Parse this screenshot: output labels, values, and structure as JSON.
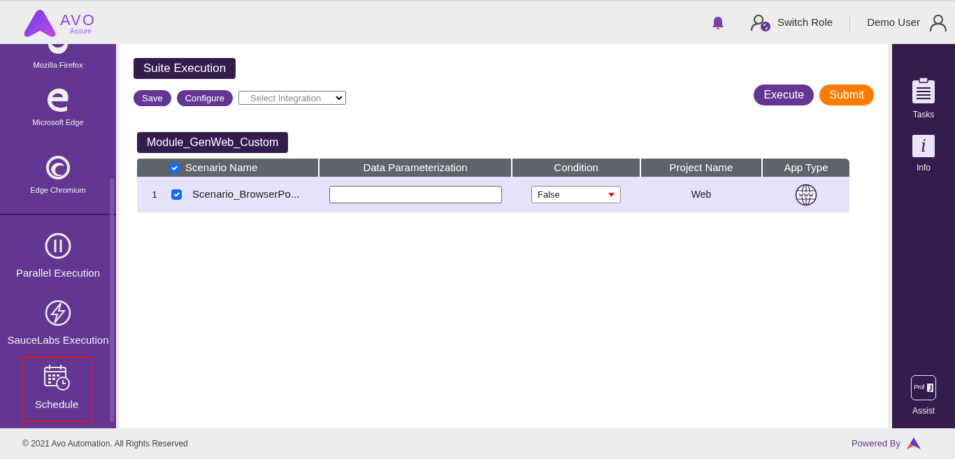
{
  "header": {
    "logo_text": "AVO",
    "logo_subtext": "Assure",
    "switch_role": "Switch Role",
    "user": "Demo User"
  },
  "sidebar": {
    "items": [
      {
        "label": "Mozilla Firefox",
        "kind": "firefox",
        "selected": false
      },
      {
        "label": "Microsoft Edge",
        "kind": "edge",
        "selected": false
      },
      {
        "label": "Edge Chromium",
        "kind": "chromium",
        "selected": false
      },
      {
        "label": "Parallel Execution",
        "kind": "parallel",
        "selected": false
      },
      {
        "label": "SauceLabs Execution",
        "kind": "saucelabs",
        "selected": false
      },
      {
        "label": "Schedule",
        "kind": "schedule",
        "selected": true
      }
    ]
  },
  "page_title": "Suite Execution",
  "toolbar": {
    "save": "Save",
    "configure": "Configure",
    "integration_placeholder": "Select Integration",
    "execute": "Execute",
    "submit": "Submit"
  },
  "module": {
    "name": "Module_GenWeb_Custom",
    "all_checked": true,
    "columns": [
      "Scenario Name",
      "Data Parameterization",
      "Condition",
      "Project Name",
      "App Type"
    ],
    "rows": [
      {
        "index": "1",
        "checked": true,
        "scenario": "Scenario_BrowserPo...",
        "condition": "False",
        "project": "Web"
      }
    ]
  },
  "right_panel": {
    "items": [
      {
        "label": "Tasks",
        "kind": "tasks"
      },
      {
        "label": "Info",
        "kind": "info",
        "glyph": "i"
      },
      {
        "label": "Assist",
        "kind": "assist",
        "glyph": "Prof"
      }
    ]
  },
  "footer": {
    "copyright": "© 2021 Avo Automation. All Rights Reserved",
    "powered_by": "Powered By"
  }
}
